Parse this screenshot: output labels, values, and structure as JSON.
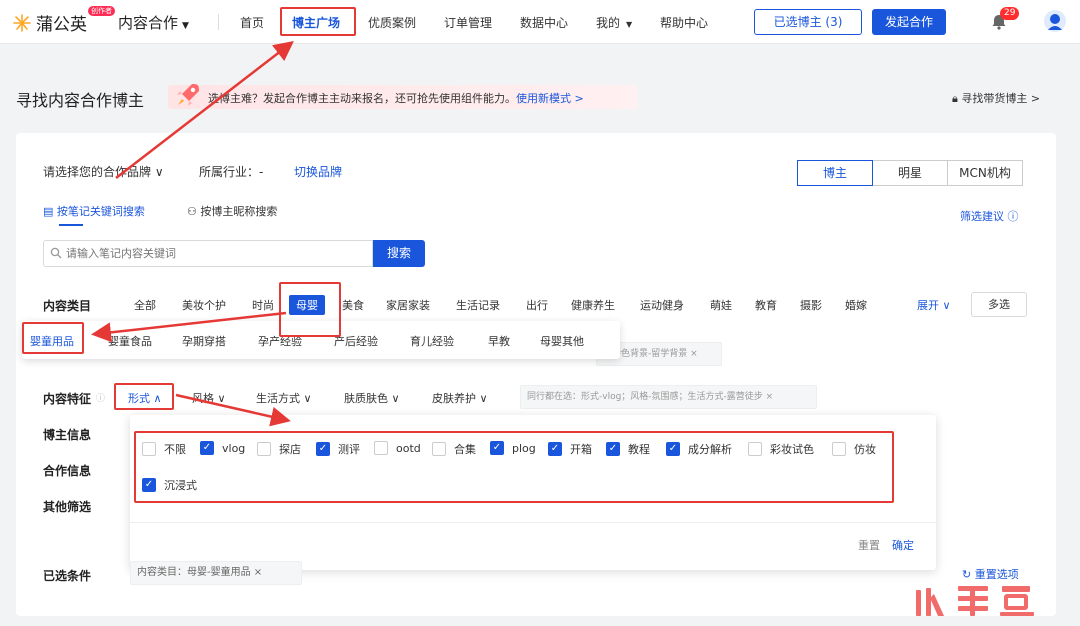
{
  "app": {
    "logo_text": "蒲公英",
    "logo_badge": "创作者",
    "module": "内容合作"
  },
  "nav": {
    "items": [
      "首页",
      "博主广场",
      "优质案例",
      "订单管理",
      "数据中心",
      "我的",
      "帮助中心"
    ],
    "selected_bloggers": "已选博主 (3)",
    "launch": "发起合作",
    "notifications": "29"
  },
  "header": {
    "title": "寻找内容合作博主",
    "promo_text": "选博主难？发起合作博主主动来报名，还可抢先使用组件能力。",
    "promo_link": "使用新模式 >",
    "find_goods": "寻找带货博主 >"
  },
  "brand": {
    "select": "请选择您的合作品牌 ∨",
    "industry": "所属行业：-",
    "switch": "切换品牌"
  },
  "type_tabs": [
    "博主",
    "明星",
    "MCN机构"
  ],
  "search": {
    "mode1": "按笔记关键词搜索",
    "mode2": "按博主昵称搜索",
    "tip": "筛选建议 ⓘ",
    "placeholder": "请输入笔记内容关键词",
    "button": "搜索"
  },
  "category": {
    "label": "内容类目",
    "items": [
      "全部",
      "美妆个护",
      "时尚",
      "母婴",
      "美食",
      "家居家装",
      "生活记录",
      "出行",
      "健康养生",
      "运动健身",
      "萌娃",
      "教育",
      "摄影",
      "婚嫁"
    ],
    "expand": "展开 ∨",
    "multi": "多选",
    "chip_text": "：特色背景-留学背景 ×"
  },
  "subcategory": {
    "items": [
      "婴童用品",
      "婴童食品",
      "孕期穿搭",
      "孕产经验",
      "产后经验",
      "育儿经验",
      "早教",
      "母婴其他"
    ]
  },
  "features": {
    "label": "内容特征",
    "active": "形式 ∧",
    "items": [
      "风格 ∨",
      "生活方式 ∨",
      "肤质肤色 ∨",
      "皮肤养护 ∨"
    ],
    "chip_text": "同行都在选：形式-vlog；风格-氛围感；生活方式-露营徒步 ×"
  },
  "side_labels": [
    "博主信息",
    "合作信息",
    "其他筛选"
  ],
  "panel": {
    "options": [
      {
        "label": "不限",
        "checked": false
      },
      {
        "label": "vlog",
        "checked": true
      },
      {
        "label": "探店",
        "checked": false
      },
      {
        "label": "测评",
        "checked": true
      },
      {
        "label": "ootd",
        "checked": false
      },
      {
        "label": "合集",
        "checked": false
      },
      {
        "label": "plog",
        "checked": true
      },
      {
        "label": "开箱",
        "checked": true
      },
      {
        "label": "教程",
        "checked": true
      },
      {
        "label": "成分解析",
        "checked": true
      },
      {
        "label": "彩妆试色",
        "checked": false
      },
      {
        "label": "仿妆",
        "checked": false
      },
      {
        "label": "沉浸式",
        "checked": true
      }
    ],
    "reset": "重置",
    "confirm": "确定"
  },
  "selected": {
    "label": "已选条件",
    "chip": "内容类目：母婴-婴童用品 ×",
    "reset": "重置选项"
  },
  "colors": {
    "accent": "#1a56db",
    "annotation": "#e53935"
  }
}
